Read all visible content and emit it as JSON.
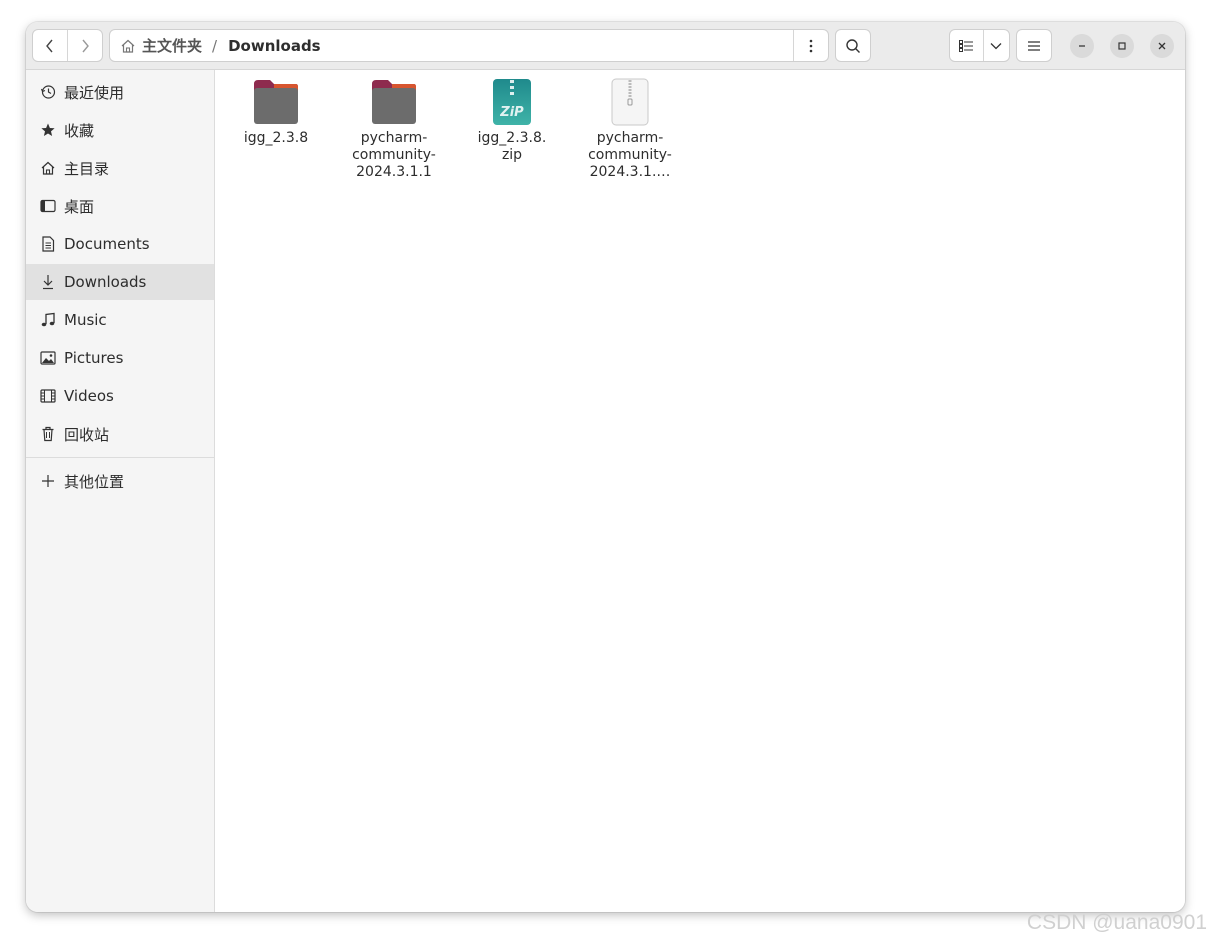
{
  "pathbar": {
    "home_label": "主文件夹",
    "separator": "/",
    "current": "Downloads"
  },
  "sidebar": {
    "items": [
      {
        "label": "最近使用",
        "icon": "clock-icon"
      },
      {
        "label": "收藏",
        "icon": "star-icon"
      },
      {
        "label": "主目录",
        "icon": "home-icon"
      },
      {
        "label": "桌面",
        "icon": "desktop-icon"
      },
      {
        "label": "Documents",
        "icon": "document-icon"
      },
      {
        "label": "Downloads",
        "icon": "download-icon",
        "active": true
      },
      {
        "label": "Music",
        "icon": "music-icon"
      },
      {
        "label": "Pictures",
        "icon": "picture-icon"
      },
      {
        "label": "Videos",
        "icon": "video-icon"
      },
      {
        "label": "回收站",
        "icon": "trash-icon"
      }
    ],
    "other_locations": {
      "label": "其他位置",
      "icon": "plus-icon"
    }
  },
  "files": [
    {
      "name_lines": [
        "igg_2.3.8"
      ],
      "type": "folder"
    },
    {
      "name_lines": [
        "pycharm-",
        "community-",
        "2024.3.1.1"
      ],
      "type": "folder"
    },
    {
      "name_lines": [
        "igg_2.3.8.",
        "zip"
      ],
      "type": "zip",
      "badge": "ZiP"
    },
    {
      "name_lines": [
        "pycharm-",
        "community-",
        "2024.3.1.…"
      ],
      "type": "archive"
    }
  ],
  "colors": {
    "folder_tab": "#8e2b4e",
    "folder_body": "#6c6c6c",
    "zip_teal": "#2c9a98",
    "active_item_bg": "#e1e1e1"
  },
  "watermark": "CSDN @uana0901"
}
